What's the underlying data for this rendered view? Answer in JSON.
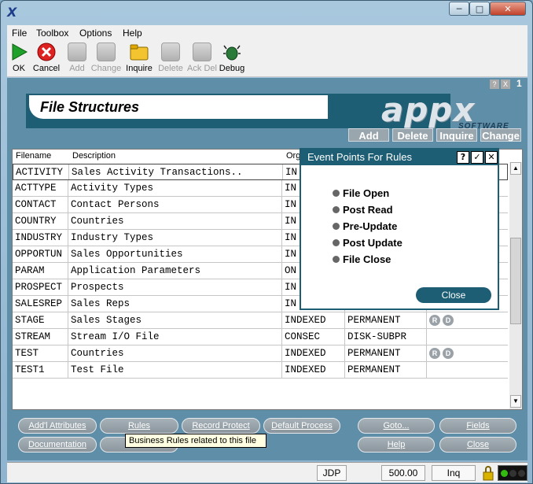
{
  "window": {
    "icon": "appx-x-icon",
    "glyph": "X"
  },
  "menubar": {
    "items": [
      "File",
      "Toolbox",
      "Options",
      "Help"
    ]
  },
  "toolbar": {
    "ok": "OK",
    "cancel": "Cancel",
    "add": "Add",
    "change": "Change",
    "inquire": "Inquire",
    "delete": "Delete",
    "ackdel": "Ack Del",
    "debug": "Debug"
  },
  "panel": {
    "level": "1",
    "help_q": "?",
    "help_x": "X"
  },
  "header": {
    "title": "File Structures",
    "logo": "appx",
    "logo_sub": "SOFTWARE"
  },
  "top_actions": {
    "add": "Add",
    "delete": "Delete",
    "inquire": "Inquire",
    "change": "Change"
  },
  "grid": {
    "columns": [
      "Filename",
      "Description",
      "Org"
    ],
    "rows": [
      {
        "name": "ACTIVITY",
        "desc": "Sales Activity Transactions..",
        "org": "IN",
        "type": "",
        "rd": ""
      },
      {
        "name": "ACTTYPE",
        "desc": "Activity Types",
        "org": "IN",
        "type": "",
        "rd": ""
      },
      {
        "name": "CONTACT",
        "desc": "Contact Persons",
        "org": "IN",
        "type": "",
        "rd": ""
      },
      {
        "name": "COUNTRY",
        "desc": "Countries",
        "org": "IN",
        "type": "",
        "rd": ""
      },
      {
        "name": "INDUSTRY",
        "desc": "Industry Types",
        "org": "IN",
        "type": "",
        "rd": ""
      },
      {
        "name": "OPPORTUN",
        "desc": "Sales Opportunities",
        "org": "IN",
        "type": "",
        "rd": ""
      },
      {
        "name": "PARAM",
        "desc": "Application Parameters",
        "org": "ON",
        "type": "",
        "rd": ""
      },
      {
        "name": "PROSPECT",
        "desc": "Prospects",
        "org": "IN",
        "type": "",
        "rd": ""
      },
      {
        "name": "SALESREP",
        "desc": "Sales Reps",
        "org": "IN",
        "type": "",
        "rd": ""
      },
      {
        "name": "STAGE",
        "desc": "Sales Stages",
        "org": "INDEXED",
        "type": "PERMANENT",
        "rd": "RD"
      },
      {
        "name": "STREAM",
        "desc": "Stream I/O File",
        "org": "CONSEC",
        "type": "DISK-SUBPR",
        "rd": ""
      },
      {
        "name": "TEST",
        "desc": "Countries",
        "org": "INDEXED",
        "type": "PERMANENT",
        "rd": "RD"
      },
      {
        "name": "TEST1",
        "desc": "Test File",
        "org": "INDEXED",
        "type": "PERMANENT",
        "rd": ""
      }
    ],
    "rd_labels": {
      "r": "R",
      "d": "D"
    }
  },
  "bottom_buttons": {
    "addl_attributes": "Add'l Attributes",
    "rules": "Rules",
    "record_protect": "Record Protect",
    "default_process": "Default Process",
    "goto": "Goto...",
    "fields": "Fields",
    "documentation": "Documentation",
    "help": "Help",
    "close": "Close"
  },
  "tooltip": "Business Rules related to this file",
  "dialog": {
    "title": "Event Points For Rules",
    "btn_help": "?",
    "btn_ok": "✓",
    "btn_close": "✕",
    "events": [
      "File Open",
      "Post Read",
      "Pre-Update",
      "Post Update",
      "File Close"
    ],
    "close_label": "Close"
  },
  "statusbar": {
    "user": "JDP",
    "version": "500.00",
    "mode": "Inq"
  },
  "colors": {
    "accent": "#1d5e74",
    "panel": "#5f8ea8"
  }
}
